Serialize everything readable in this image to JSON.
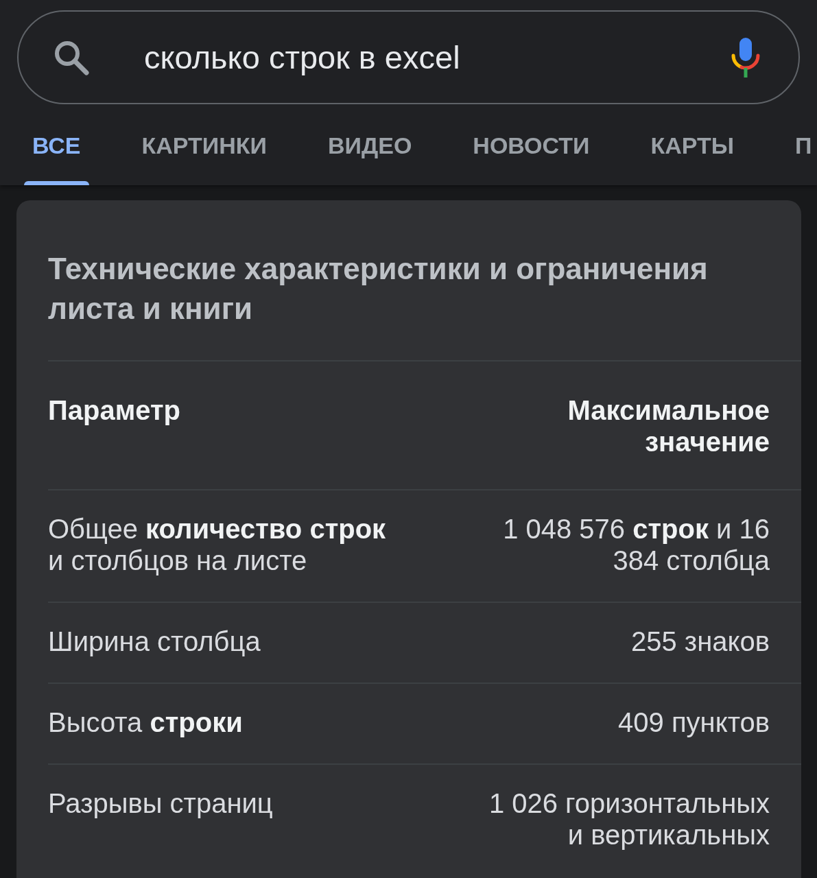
{
  "search": {
    "value": "сколько строк в excel"
  },
  "tabs": [
    {
      "label": "ВСЕ",
      "selected": true
    },
    {
      "label": "КАРТИНКИ",
      "selected": false
    },
    {
      "label": "ВИДЕО",
      "selected": false
    },
    {
      "label": "НОВОСТИ",
      "selected": false
    },
    {
      "label": "КАРТЫ",
      "selected": false
    },
    {
      "label": "П",
      "selected": false
    }
  ],
  "card": {
    "title": "Технические характеристики и ограничения листа и книги",
    "table": {
      "columns": [
        "Параметр",
        "Максимальное значение"
      ],
      "rows": [
        {
          "parameter": "Общее **количество строк** и столбцов на листе",
          "value": "1 048 576 **строк** и 16 384 столбца"
        },
        {
          "parameter": "Ширина столбца",
          "value": "255 знаков"
        },
        {
          "parameter": "Высота **строки**",
          "value": "409 пунктов"
        },
        {
          "parameter": "Разрывы страниц",
          "value": "1 026 горизонтальных и вертикальных"
        }
      ]
    }
  }
}
